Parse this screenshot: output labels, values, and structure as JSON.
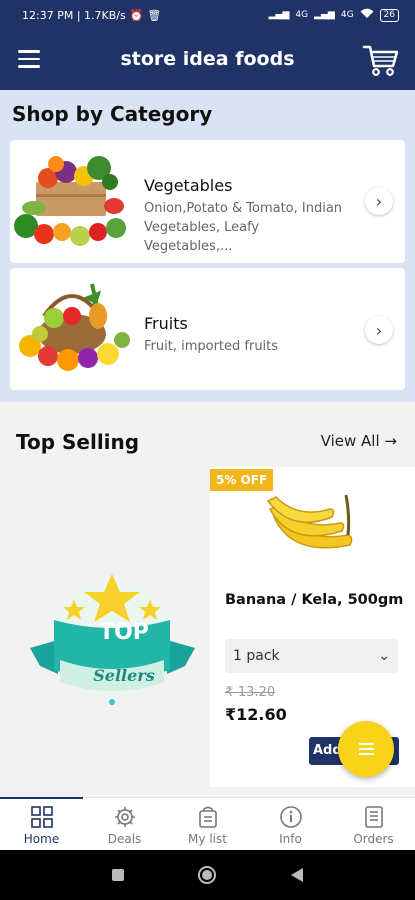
{
  "status_bar": {
    "time_speed": "12:37 PM | 1.7KB/s",
    "network": "4G",
    "network2": "4G",
    "battery": "26"
  },
  "header": {
    "title": "store idea foods"
  },
  "categories": {
    "title": "Shop by Category",
    "items": [
      {
        "name": "Vegetables",
        "desc_line1": "Onion,Potato & Tomato, Indian",
        "desc_line2": "Vegetables, Leafy Vegetables,..."
      },
      {
        "name": "Fruits",
        "desc_line1": "Fruit, imported fruits"
      }
    ]
  },
  "top_selling": {
    "title": "Top Selling",
    "view_all": "View All",
    "badge_top": "TOP",
    "badge_sub": "Sellers",
    "product": {
      "discount": "5% OFF",
      "name": "Banana / Kela, 500gm",
      "pack": "1 pack",
      "old_price": "₹-13.20",
      "price": "₹12.60",
      "add_label": "Add"
    }
  },
  "bottom_nav": [
    {
      "label": "Home",
      "icon": "home-grid-icon",
      "active": true
    },
    {
      "label": "Deals",
      "icon": "gear-icon"
    },
    {
      "label": "My list",
      "icon": "list-bag-icon"
    },
    {
      "label": "Info",
      "icon": "info-icon"
    },
    {
      "label": "Orders",
      "icon": "orders-icon"
    }
  ],
  "colors": {
    "primary": "#1f3366",
    "accent": "#f9d21a",
    "badge": "#f2b61b",
    "category_bg": "#d9e3f3"
  }
}
